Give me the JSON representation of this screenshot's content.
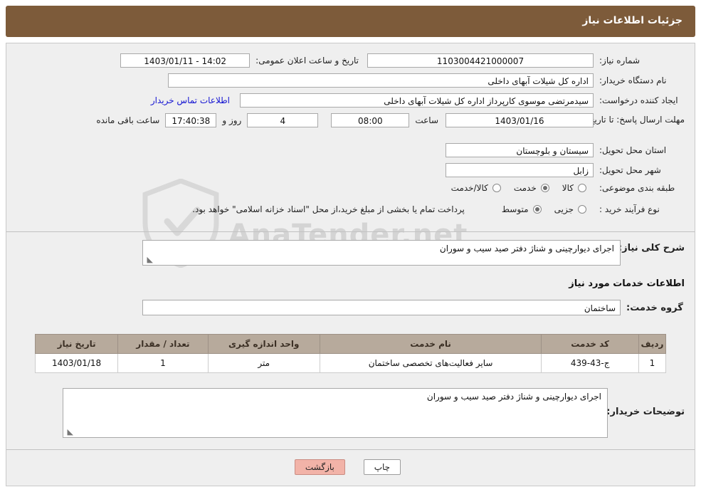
{
  "header": {
    "title": "جزئیات اطلاعات نیاز"
  },
  "form": {
    "need_number_label": "شماره نیاز:",
    "need_number_value": "1103004421000007",
    "announce_datetime_label": "تاریخ و ساعت اعلان عمومی:",
    "announce_datetime_value": "14:02 - 1403/01/11",
    "buyer_org_label": "نام دستگاه خریدار:",
    "buyer_org_value": "اداره کل شیلات آبهای داخلی",
    "requester_label": "ایجاد کننده درخواست:",
    "requester_value": "سیدمرتضی موسوی کارپرداز اداره کل شیلات آبهای داخلی",
    "contact_link": "اطلاعات تماس خریدار",
    "deadline_label": "مهلت ارسال پاسخ: تا تاریخ:",
    "deadline_date": "1403/01/16",
    "time_label": "ساعت",
    "deadline_time": "08:00",
    "days_value": "4",
    "days_label": "روز و",
    "remaining_time": "17:40:38",
    "remaining_label": "ساعت باقی مانده",
    "province_label": "استان محل تحویل:",
    "province_value": "سیستان و بلوچستان",
    "city_label": "شهر محل تحویل:",
    "city_value": "زابل",
    "category_label": "طبقه بندی موضوعی:",
    "category_options": [
      {
        "label": "کالا",
        "checked": false
      },
      {
        "label": "خدمت",
        "checked": true
      },
      {
        "label": "کالا/خدمت",
        "checked": false
      }
    ],
    "purchase_type_label": "نوع فرآیند خرید :",
    "purchase_type_options": [
      {
        "label": "جزیی",
        "checked": false
      },
      {
        "label": "متوسط",
        "checked": true
      }
    ],
    "purchase_note": "پرداخت تمام یا بخشی از مبلغ خرید،از محل \"اسناد خزانه اسلامی\" خواهد بود."
  },
  "summary": {
    "label": "شرح کلی نیاز:",
    "value": "اجرای دیوارچینی و شناژ دفتر صید سیب و سوران"
  },
  "services": {
    "section_title": "اطلاعات خدمات مورد نیاز",
    "group_label": "گروه خدمت:",
    "group_value": "ساختمان",
    "columns": [
      "ردیف",
      "کد خدمت",
      "نام خدمت",
      "واحد اندازه گیری",
      "تعداد / مقدار",
      "تاریخ نیاز"
    ],
    "rows": [
      {
        "index": "1",
        "code": "ج-43-439",
        "name": "سایر فعالیت‌های تخصصی ساختمان",
        "unit": "متر",
        "quantity": "1",
        "date": "1403/01/18"
      }
    ]
  },
  "buyer_notes": {
    "label": "توضیحات خریدار:",
    "value": "اجرای دیوارچینی و شناژ دفتر صید سیب و سوران"
  },
  "footer": {
    "print_label": "چاپ",
    "back_label": "بازگشت"
  },
  "watermark": {
    "text": "AnaTender.net"
  },
  "colors": {
    "header_bg": "#7d5b3a",
    "panel_bg": "#efefef",
    "table_header_bg": "#b7aa9c",
    "link": "#1414d2",
    "back_button": "#f2b3a8"
  }
}
